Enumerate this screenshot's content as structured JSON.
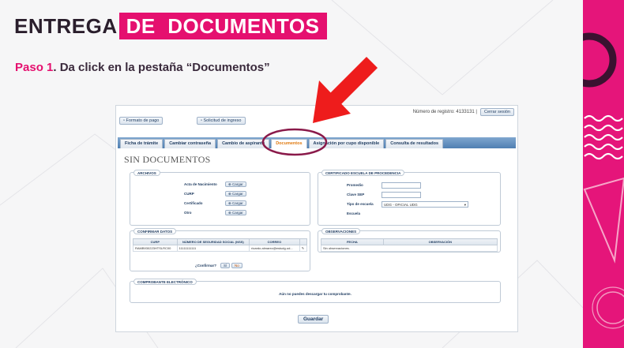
{
  "slide": {
    "title_part1": "ENTREGA",
    "title_part2": "DE  DOCUMENTOS",
    "step_prefix": "Paso 1",
    "step_text": ". Da click en la pestaña “Documentos”",
    "colors": {
      "accent": "#e5106f",
      "dark": "#2a1e2c",
      "sidebar": "#e5157a",
      "highlight_oval": "#8a1a4a",
      "arrow": "#ee1c1c"
    }
  },
  "app": {
    "registro_label": "Número de registro: 4133131 |",
    "logout": "Cerrar sesión",
    "formato_pago": "Formato de pago",
    "solicitud_ingreso": "Solicitud de ingreso",
    "tabs": [
      {
        "label": "Ficha de trámite"
      },
      {
        "label": "Cambiar contraseña"
      },
      {
        "label": "Cambio de aspirante"
      },
      {
        "label": "Documentos",
        "active": true
      },
      {
        "label": "Asignación por cupo disponible"
      },
      {
        "label": "Consulta de resultados"
      }
    ],
    "heading": "SIN DOCUMENTOS",
    "archivos": {
      "legend": "ARCHIVOS",
      "rows": [
        {
          "label": "Acta de Nacimiento",
          "button": "Cargar"
        },
        {
          "label": "CURP",
          "button": "Cargar"
        },
        {
          "label": "Certificado",
          "button": "Cargar"
        },
        {
          "label": "Otro",
          "button": "Cargar"
        }
      ]
    },
    "certificado": {
      "legend": "CERTIFICADO ESCUELA DE PROCEDENCIA",
      "promedio": "Promedio",
      "clave": "Clave SEP",
      "tipo": "Tipo de escuela",
      "tipo_value": "UDG - OFICIAL UDG",
      "escuela": "Escuela"
    },
    "confirmar": {
      "legend": "CONFIRMAR DATOS",
      "headers": [
        "CURP",
        "NÚMERO DE SEGURIDAD SOCIAL (NSS)",
        "CORREO",
        ""
      ],
      "row": [
        "RAMB930223HTSLRC00",
        "11111111111",
        "ricardo.almarez@estudg.ud...",
        "✎"
      ],
      "question": "¿Confirmar?",
      "yes": "Sí",
      "no": "No"
    },
    "observaciones": {
      "legend": "OBSERVACIONES",
      "headers": [
        "FECHA",
        "OBSERVACIÓN"
      ],
      "empty": "Sin observaciones."
    },
    "comprobante": {
      "legend": "COMPROBANTE ELECTRÓNICO",
      "message": "Aún no puedes descargar tu comprobante."
    },
    "guardar": "Guardar"
  }
}
